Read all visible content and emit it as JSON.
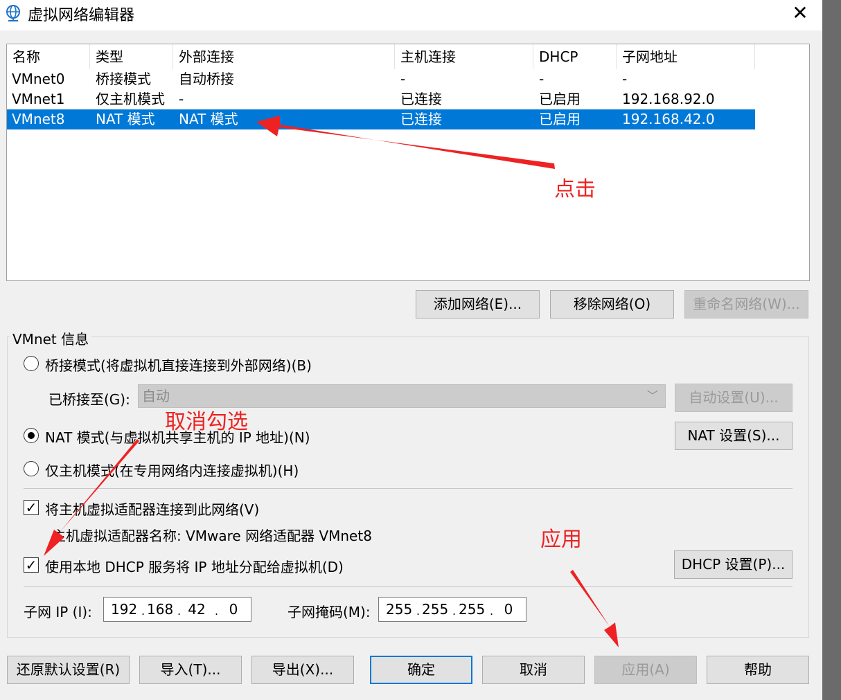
{
  "window": {
    "title": "虚拟网络编辑器",
    "close": "✕"
  },
  "columns": [
    "名称",
    "类型",
    "外部连接",
    "主机连接",
    "DHCP",
    "子网地址"
  ],
  "networks": [
    {
      "name": "VMnet0",
      "type": "桥接模式",
      "external": "自动桥接",
      "host": "-",
      "dhcp": "-",
      "subnet": "-"
    },
    {
      "name": "VMnet1",
      "type": "仅主机模式",
      "external": "-",
      "host": "已连接",
      "dhcp": "已启用",
      "subnet": "192.168.92.0"
    },
    {
      "name": "VMnet8",
      "type": "NAT 模式",
      "external": "NAT 模式",
      "host": "已连接",
      "dhcp": "已启用",
      "subnet": "192.168.42.0",
      "selected": true
    }
  ],
  "list_buttons": {
    "add": "添加网络(E)...",
    "remove": "移除网络(O)",
    "rename": "重命名网络(W)..."
  },
  "vmnet_info": {
    "label": "VMnet 信息",
    "bridge_radio": "桥接模式(将虚拟机直接连接到外部网络)(B)",
    "bridged_to_label": "已桥接至(G):",
    "bridged_to_value": "自动",
    "auto_settings": "自动设置(U)...",
    "nat_radio": "NAT 模式(与虚拟机共享主机的 IP 地址)(N)",
    "nat_settings": "NAT 设置(S)...",
    "hostonly_radio": "仅主机模式(在专用网络内连接虚拟机)(H)",
    "connect_adapter": "将主机虚拟适配器连接到此网络(V)",
    "adapter_name": "主机虚拟适配器名称: VMware 网络适配器 VMnet8",
    "use_dhcp": "使用本地 DHCP 服务将 IP 地址分配给虚拟机(D)",
    "dhcp_settings": "DHCP 设置(P)...",
    "subnet_ip_label": "子网 IP (I):",
    "subnet_ip": [
      "192",
      "168",
      "42",
      "0"
    ],
    "subnet_mask_label": "子网掩码(M):",
    "subnet_mask": [
      "255",
      "255",
      "255",
      "0"
    ],
    "selected_mode": "nat",
    "connect_adapter_checked": true,
    "use_dhcp_checked": true
  },
  "bottom_buttons": {
    "restore": "还原默认设置(R)",
    "import": "导入(T)...",
    "export": "导出(X)...",
    "ok": "确定",
    "cancel": "取消",
    "apply": "应用(A)",
    "help": "帮助"
  },
  "annotations": {
    "click": "点击",
    "uncheck": "取消勾选",
    "apply": "应用",
    "color": "#ee2222"
  },
  "icons": {
    "app": "globe-network-icon",
    "dropdown": "chevron-down-icon"
  }
}
